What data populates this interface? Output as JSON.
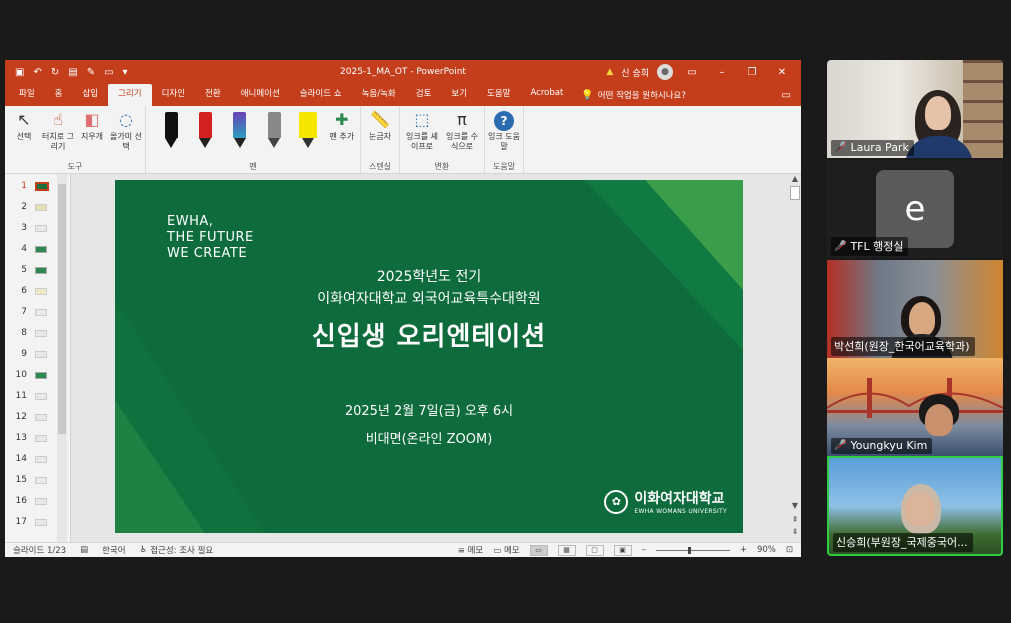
{
  "app": {
    "doc_title": "2025-1_MA_OT",
    "app_name": "PowerPoint",
    "user_name": "신 승희",
    "colors": {
      "accent": "#c43e1c",
      "slide_bg": "#0d6b3c"
    }
  },
  "tabs": [
    "파일",
    "홈",
    "삽입",
    "그리기",
    "디자인",
    "전환",
    "애니메이션",
    "슬라이드 쇼",
    "녹음/녹화",
    "검토",
    "보기",
    "도움말",
    "Acrobat"
  ],
  "active_tab": "그리기",
  "tell_me": "어떤 작업을 원하시나요?",
  "ribbon": {
    "tools": {
      "label": "도구",
      "select": "선택",
      "touch_draw": "터치로 그리기",
      "eraser": "지우개",
      "lasso": "올가미 선택"
    },
    "pens": {
      "label": "펜",
      "add_pen": "펜 추가"
    },
    "stencil": {
      "label": "스텐실",
      "ruler": "눈금자"
    },
    "convert": {
      "label": "변환",
      "ink_to_shape": "잉크를 셰이프로",
      "ink_to_math": "잉크를 수식으로"
    },
    "help": {
      "label": "도움말",
      "ink_help": "잉크 도움말"
    }
  },
  "thumbnails": [
    "1",
    "2",
    "3",
    "4",
    "5",
    "6",
    "7",
    "8",
    "9",
    "10",
    "11",
    "12",
    "13",
    "14",
    "15",
    "16",
    "17"
  ],
  "slide": {
    "brand_line1": "EWHA,",
    "brand_line2": "THE FUTURE",
    "brand_line3": "WE CREATE",
    "line1": "2025학년도 전기",
    "line2": "이화여자대학교 외국어교육특수대학원",
    "title": "신입생 오리엔테이션",
    "date": "2025년 2월 7일(금)  오후 6시",
    "mode": "비대면(온라인 ZOOM)",
    "uni_ko": "이화여자대학교",
    "uni_en": "EWHA WOMANS UNIVERSITY"
  },
  "statusbar": {
    "slide_pos": "슬라이드 1/23",
    "language": "한국어",
    "accessibility": "접근성: 조사 필요",
    "notes": "메모",
    "comments": "메모",
    "zoom": "90%"
  },
  "participants": [
    {
      "name": "Laura Park"
    },
    {
      "name": "TFL 행정실",
      "avatar_letter": "e"
    },
    {
      "name": "박선희(원장_한국어교육학과)"
    },
    {
      "name": "Youngkyu Kim"
    },
    {
      "name": "신승희(부원장_국제중국어..."
    }
  ]
}
